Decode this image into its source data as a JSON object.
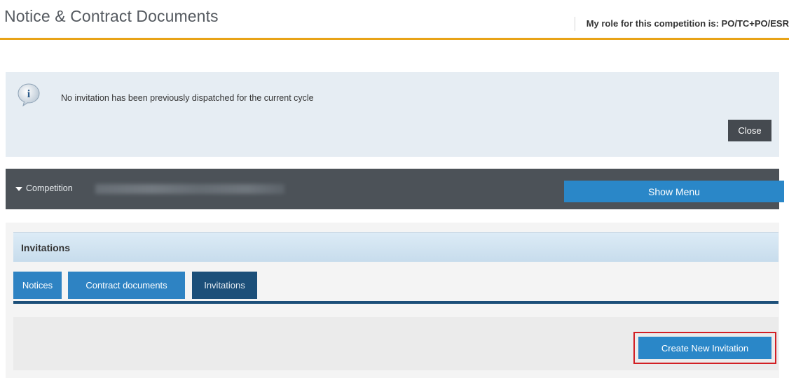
{
  "header": {
    "title": "Notice & Contract Documents",
    "role_text": "My role for this competition is: PO/TC+PO/ESR"
  },
  "info": {
    "icon": "info-icon",
    "message": "No invitation has been previously dispatched for the current cycle",
    "close_label": "Close"
  },
  "competition": {
    "label": "Competition",
    "show_menu_label": "Show Menu"
  },
  "panel": {
    "title": "Invitations",
    "tabs": [
      {
        "label": "Notices"
      },
      {
        "label": "Contract documents"
      },
      {
        "label": "Invitations"
      }
    ],
    "create_label": "Create New Invitation"
  },
  "colors": {
    "accent": "#e8a317",
    "primary_button": "#2a87c8",
    "highlight_outline": "#d21f24",
    "dark_bar": "#4c5258"
  }
}
